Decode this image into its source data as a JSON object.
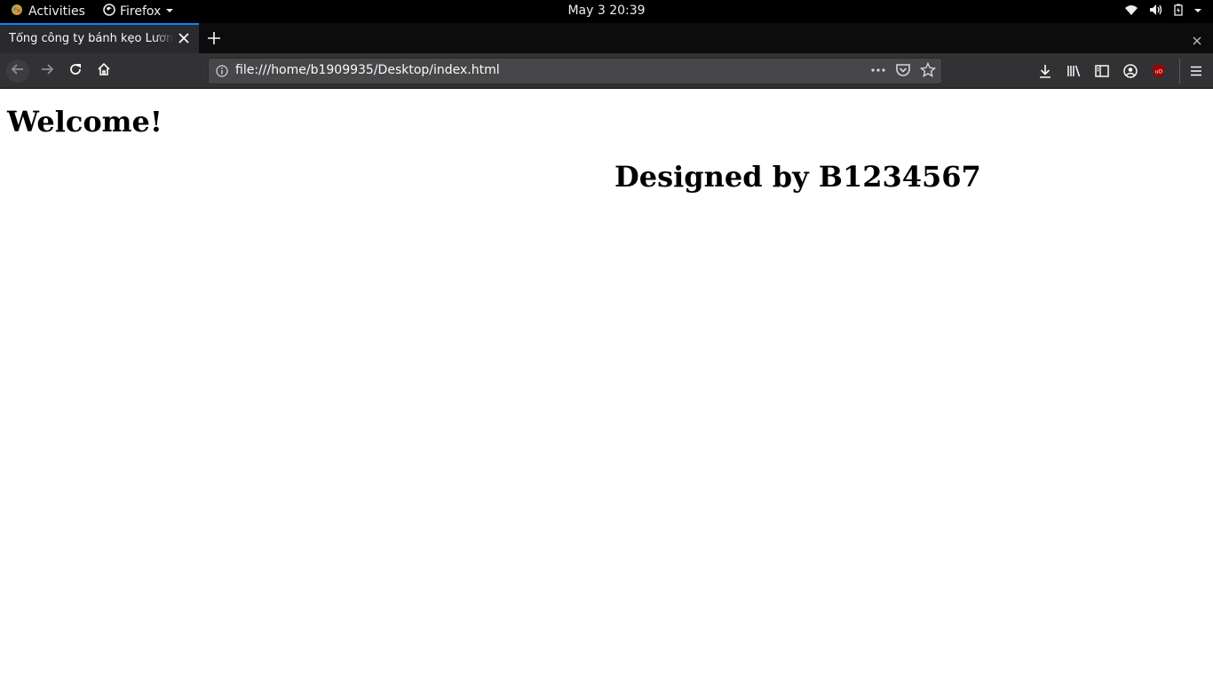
{
  "topbar": {
    "activities_label": "Activities",
    "app_label": "Firefox",
    "clock": "May 3  20:39"
  },
  "tab": {
    "title": "Tổng công ty bánh kẹo Lương"
  },
  "urlbar": {
    "url": "file:///home/b1909935/Desktop/index.html"
  },
  "page": {
    "heading": "Welcome!",
    "designed_by": "Designed by B1234567"
  },
  "icons": {
    "back": "arrow-left-icon",
    "forward": "arrow-right-icon",
    "reload": "reload-icon",
    "home": "home-icon",
    "downloads": "download-icon",
    "library": "library-icon",
    "sidebar": "sidebar-icon",
    "account": "account-icon",
    "ublock": "ublock-icon",
    "menu": "hamburger-menu-icon"
  },
  "colors": {
    "tab_accent": "#0a84ff",
    "toolbar_bg": "#323234",
    "tabbar_bg": "#0c0c0d",
    "ublock_red": "#a00000"
  }
}
